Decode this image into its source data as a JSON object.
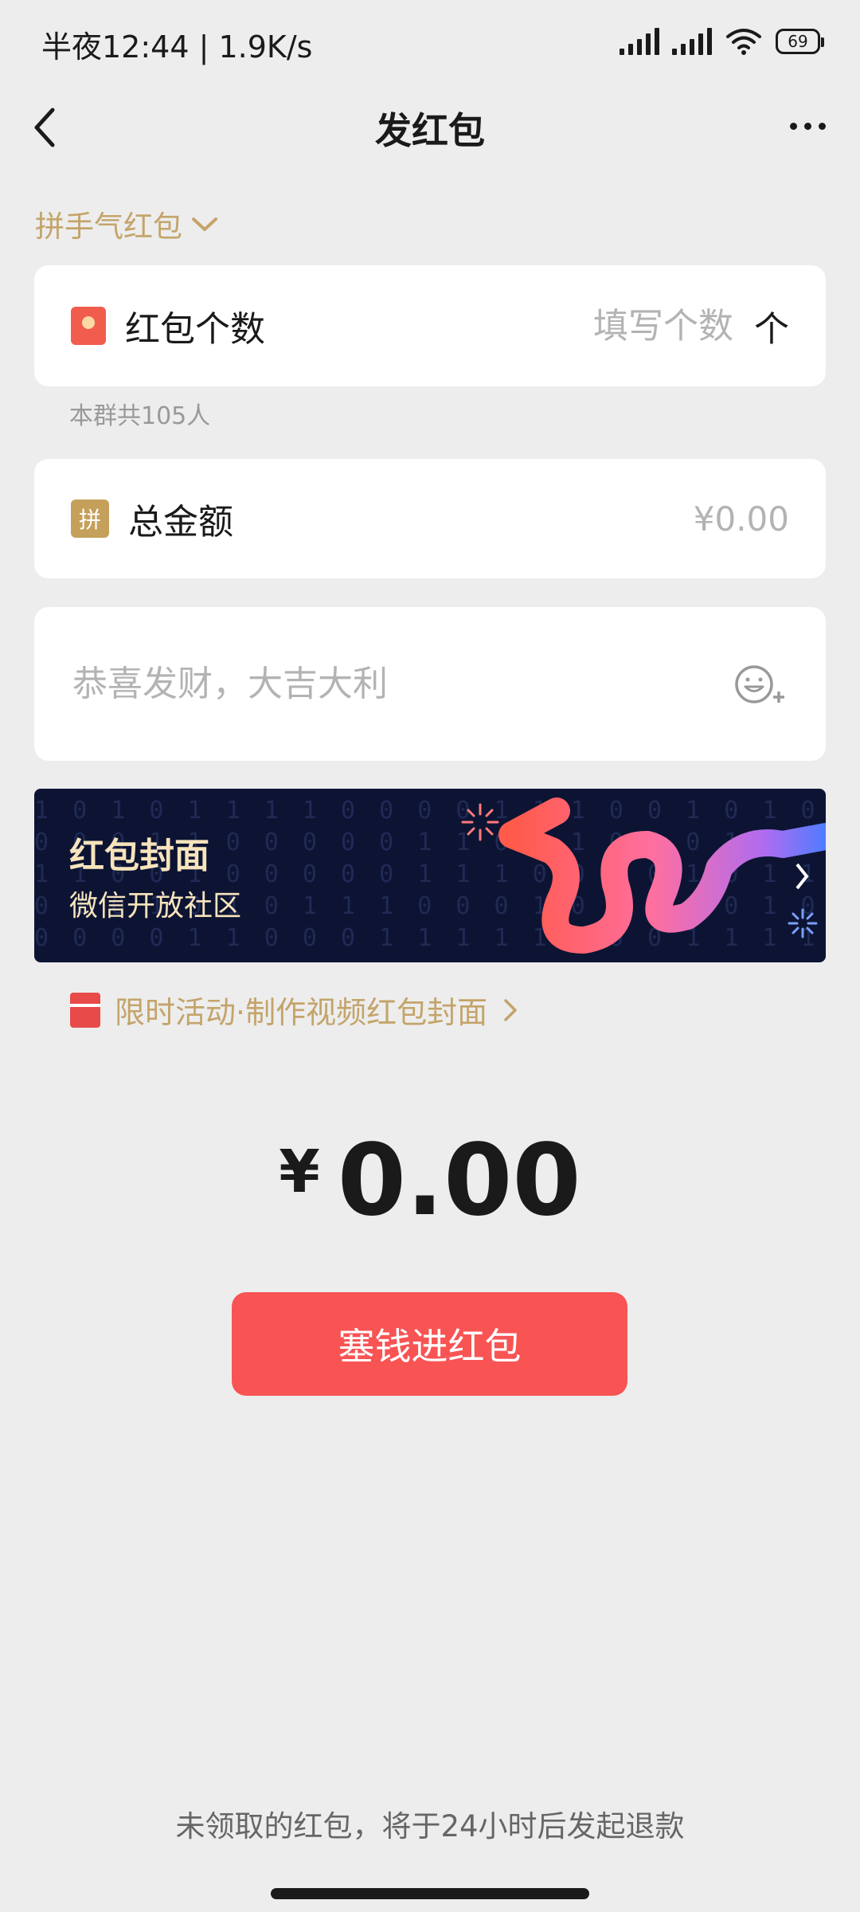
{
  "status_bar": {
    "time_speed": "半夜12:44 | 1.9K/s",
    "battery": "69"
  },
  "nav": {
    "title": "发红包"
  },
  "type_selector": {
    "label": "拼手气红包"
  },
  "count_row": {
    "label": "红包个数",
    "placeholder": "填写个数",
    "unit": "个"
  },
  "group_hint": "本群共105人",
  "amount_row": {
    "icon_text": "拼",
    "label": "总金额",
    "value": "¥0.00"
  },
  "greeting": {
    "placeholder": "恭喜发财，大吉大利"
  },
  "cover_banner": {
    "title": "红包封面",
    "subtitle": "微信开放社区"
  },
  "promo": {
    "label": "限时活动·制作视频红包封面"
  },
  "total": {
    "currency": "¥",
    "value": "0.00"
  },
  "submit": {
    "label": "塞钱进红包"
  },
  "footer_note": "未领取的红包，将于24小时后发起退款",
  "colors": {
    "accent_gold": "#c4a46a",
    "button_red": "#f85454",
    "banner_bg": "#0d1433"
  },
  "icons": [
    "back-icon",
    "more-icon",
    "chevron-down-icon",
    "red-packet-icon",
    "emoji-add-icon",
    "chevron-right-icon"
  ]
}
